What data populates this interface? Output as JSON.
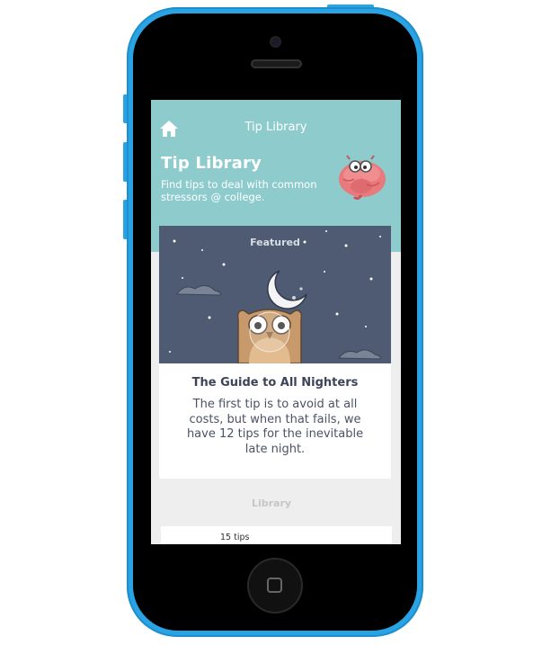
{
  "nav": {
    "title": "Tip Library",
    "home_icon": "home-icon"
  },
  "header": {
    "title": "Tip Library",
    "subtitle": "Find tips to deal with common stressors @ college.",
    "mascot_icon": "brain-with-glasses-icon"
  },
  "featured": {
    "label": "Featured",
    "title": "The Guide to All Nighters",
    "description": "The first tip is to avoid at all costs, but when that fails, we have 12 tips for the inevitable late night."
  },
  "library": {
    "label": "Library",
    "items": [
      {
        "count": "15 tips"
      }
    ]
  },
  "colors": {
    "phone": "#29a3e3",
    "header": "#8ecbcd",
    "night_sky": "#4f5b72",
    "text_dark": "#3c4456"
  }
}
